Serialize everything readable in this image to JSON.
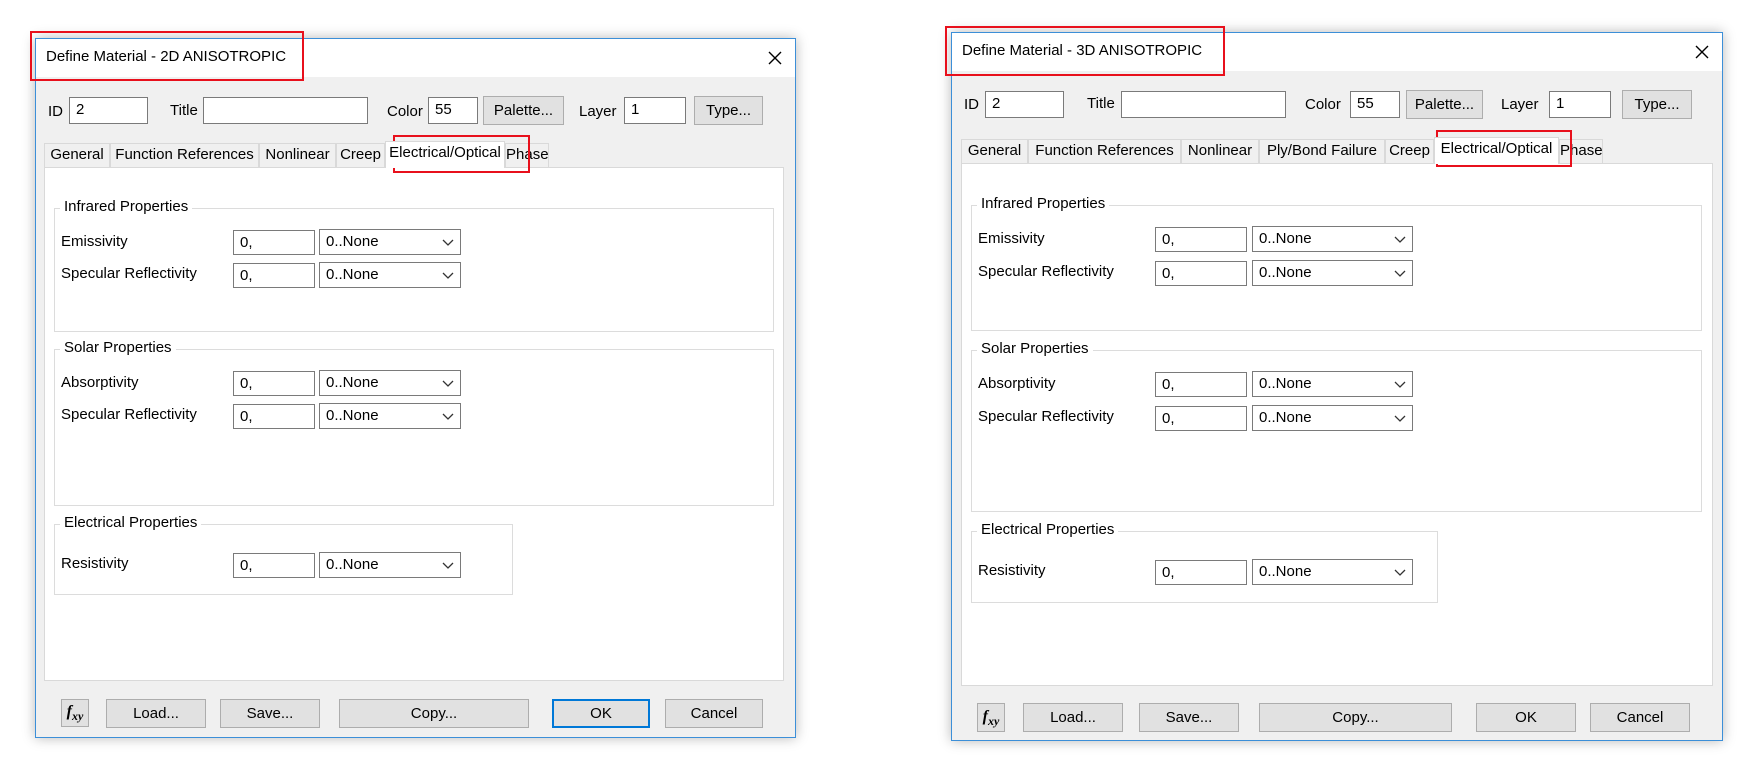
{
  "dialogs": [
    {
      "title": "Define Material - 2D ANISOTROPIC",
      "header": {
        "id_label": "ID",
        "id_value": "2",
        "title_label": "Title",
        "title_value": "",
        "color_label": "Color",
        "color_value": "55",
        "palette_button": "Palette...",
        "layer_label": "Layer",
        "layer_value": "1",
        "type_button": "Type..."
      },
      "tabs": [
        "General",
        "Function References",
        "Nonlinear",
        "Creep",
        "Electrical/Optical",
        "Phase"
      ],
      "active_tab": "Electrical/Optical",
      "groups": [
        {
          "title": "Infrared Properties",
          "rows": [
            {
              "label": "Emissivity",
              "value": "0,",
              "function": "0..None"
            },
            {
              "label": "Specular Reflectivity",
              "value": "0,",
              "function": "0..None"
            }
          ]
        },
        {
          "title": "Solar Properties",
          "rows": [
            {
              "label": "Absorptivity",
              "value": "0,",
              "function": "0..None"
            },
            {
              "label": "Specular Reflectivity",
              "value": "0,",
              "function": "0..None"
            }
          ]
        },
        {
          "title": "Electrical Properties",
          "rows": [
            {
              "label": "Resistivity",
              "value": "0,",
              "function": "0..None"
            }
          ]
        }
      ],
      "footer": {
        "fxy": "f",
        "fxy_sub": "xy",
        "load": "Load...",
        "save": "Save...",
        "copy": "Copy...",
        "ok": "OK",
        "cancel": "Cancel"
      }
    },
    {
      "title": "Define Material - 3D ANISOTROPIC",
      "header": {
        "id_label": "ID",
        "id_value": "2",
        "title_label": "Title",
        "title_value": "",
        "color_label": "Color",
        "color_value": "55",
        "palette_button": "Palette...",
        "layer_label": "Layer",
        "layer_value": "1",
        "type_button": "Type..."
      },
      "tabs": [
        "General",
        "Function References",
        "Nonlinear",
        "Ply/Bond Failure",
        "Creep",
        "Electrical/Optical",
        "Phase"
      ],
      "active_tab": "Electrical/Optical",
      "groups": [
        {
          "title": "Infrared Properties",
          "rows": [
            {
              "label": "Emissivity",
              "value": "0,",
              "function": "0..None"
            },
            {
              "label": "Specular Reflectivity",
              "value": "0,",
              "function": "0..None"
            }
          ]
        },
        {
          "title": "Solar Properties",
          "rows": [
            {
              "label": "Absorptivity",
              "value": "0,",
              "function": "0..None"
            },
            {
              "label": "Specular Reflectivity",
              "value": "0,",
              "function": "0..None"
            }
          ]
        },
        {
          "title": "Electrical Properties",
          "rows": [
            {
              "label": "Resistivity",
              "value": "0,",
              "function": "0..None"
            }
          ]
        }
      ],
      "footer": {
        "fxy": "f",
        "fxy_sub": "xy",
        "load": "Load...",
        "save": "Save...",
        "copy": "Copy...",
        "ok": "OK",
        "cancel": "Cancel"
      }
    }
  ],
  "icons": {
    "close": "close-icon",
    "dropdown": "chevron-down-icon",
    "function": "fxy-icon"
  },
  "colors": {
    "highlight": "#e8101c",
    "window_border": "#3c8fd8",
    "default_button_border": "#0078d7",
    "dialog_bg": "#f0f0f0"
  }
}
